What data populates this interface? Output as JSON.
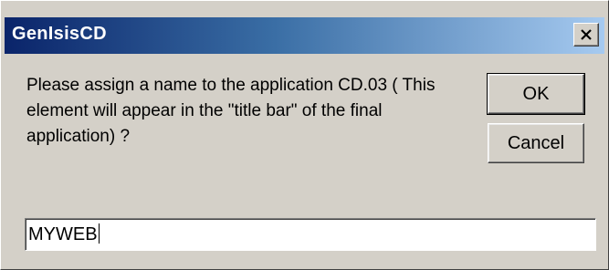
{
  "window": {
    "title": "GenIsisCD"
  },
  "message": {
    "text": "Please assign a name to the application CD.03 ( This element will appear in the \"title bar\" of the final application) ?"
  },
  "buttons": {
    "ok_label": "OK",
    "cancel_label": "Cancel"
  },
  "input": {
    "value": "MYWEB"
  },
  "icons": {
    "close": "close-icon"
  }
}
